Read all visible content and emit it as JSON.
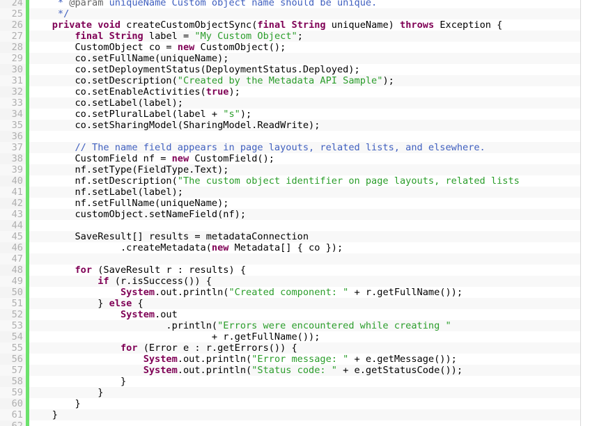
{
  "colors": {
    "gutter_background": "#f4f4f4",
    "accent_bar": "#6ce26c",
    "keyword": "#7f0055",
    "string": "#2a9d2a",
    "comment": "#3f5fbf",
    "line_number": "#afafaf"
  },
  "code": {
    "lines": [
      {
        "n": "24",
        "tokens": [
          [
            "     * ",
            "doc"
          ],
          [
            "@param",
            "ann"
          ],
          [
            " uniqueName Custom object name should be unique.",
            "doc"
          ]
        ]
      },
      {
        "n": "25",
        "tokens": [
          [
            "     */",
            "doc"
          ]
        ]
      },
      {
        "n": "26",
        "tokens": [
          [
            "    ",
            "t"
          ],
          [
            "private",
            "kw"
          ],
          [
            " ",
            "t"
          ],
          [
            "void",
            "kw"
          ],
          [
            " createCustomObjectSync(",
            "t"
          ],
          [
            "final",
            "kw"
          ],
          [
            " ",
            "t"
          ],
          [
            "String",
            "kw"
          ],
          [
            " uniqueName) ",
            "t"
          ],
          [
            "throws",
            "kw"
          ],
          [
            " Exception {",
            "t"
          ]
        ]
      },
      {
        "n": "27",
        "tokens": [
          [
            "        ",
            "t"
          ],
          [
            "final",
            "kw"
          ],
          [
            " ",
            "t"
          ],
          [
            "String",
            "kw"
          ],
          [
            " label = ",
            "t"
          ],
          [
            "\"My Custom Object\"",
            "str"
          ],
          [
            ";",
            "t"
          ]
        ]
      },
      {
        "n": "28",
        "tokens": [
          [
            "        CustomObject co = ",
            "t"
          ],
          [
            "new",
            "kw"
          ],
          [
            " CustomObject();",
            "t"
          ]
        ]
      },
      {
        "n": "29",
        "tokens": [
          [
            "        co.setFullName(uniqueName);",
            "t"
          ]
        ]
      },
      {
        "n": "30",
        "tokens": [
          [
            "        co.setDeploymentStatus(DeploymentStatus.Deployed);",
            "t"
          ]
        ]
      },
      {
        "n": "31",
        "tokens": [
          [
            "        co.setDescription(",
            "t"
          ],
          [
            "\"Created by the Metadata API Sample\"",
            "str"
          ],
          [
            ");",
            "t"
          ]
        ]
      },
      {
        "n": "32",
        "tokens": [
          [
            "        co.setEnableActivities(",
            "t"
          ],
          [
            "true",
            "kw"
          ],
          [
            ");",
            "t"
          ]
        ]
      },
      {
        "n": "33",
        "tokens": [
          [
            "        co.setLabel(label);",
            "t"
          ]
        ]
      },
      {
        "n": "34",
        "tokens": [
          [
            "        co.setPluralLabel(label + ",
            "t"
          ],
          [
            "\"s\"",
            "str"
          ],
          [
            ");",
            "t"
          ]
        ]
      },
      {
        "n": "35",
        "tokens": [
          [
            "        co.setSharingModel(SharingModel.ReadWrite);",
            "t"
          ]
        ]
      },
      {
        "n": "36",
        "tokens": []
      },
      {
        "n": "37",
        "tokens": [
          [
            "        ",
            "t"
          ],
          [
            "// The name field appears in page layouts, related lists, and elsewhere.",
            "cm"
          ]
        ]
      },
      {
        "n": "38",
        "tokens": [
          [
            "        CustomField nf = ",
            "t"
          ],
          [
            "new",
            "kw"
          ],
          [
            " CustomField();",
            "t"
          ]
        ]
      },
      {
        "n": "39",
        "tokens": [
          [
            "        nf.setType(FieldType.Text);",
            "t"
          ]
        ]
      },
      {
        "n": "40",
        "tokens": [
          [
            "        nf.setDescription(",
            "t"
          ],
          [
            "\"The custom object identifier on page layouts, related lists",
            "str"
          ]
        ]
      },
      {
        "n": "41",
        "tokens": [
          [
            "        nf.setLabel(label);",
            "t"
          ]
        ]
      },
      {
        "n": "42",
        "tokens": [
          [
            "        nf.setFullName(uniqueName);",
            "t"
          ]
        ]
      },
      {
        "n": "43",
        "tokens": [
          [
            "        customObject.setNameField(nf);",
            "t"
          ]
        ]
      },
      {
        "n": "44",
        "tokens": []
      },
      {
        "n": "45",
        "tokens": [
          [
            "        SaveResult[] results = metadataConnection",
            "t"
          ]
        ]
      },
      {
        "n": "46",
        "tokens": [
          [
            "                .createMetadata(",
            "t"
          ],
          [
            "new",
            "kw"
          ],
          [
            " Metadata[] { co });",
            "t"
          ]
        ]
      },
      {
        "n": "47",
        "tokens": []
      },
      {
        "n": "48",
        "tokens": [
          [
            "        ",
            "t"
          ],
          [
            "for",
            "kw"
          ],
          [
            " (SaveResult r : results) {",
            "t"
          ]
        ]
      },
      {
        "n": "49",
        "tokens": [
          [
            "            ",
            "t"
          ],
          [
            "if",
            "kw"
          ],
          [
            " (r.isSuccess()) {",
            "t"
          ]
        ]
      },
      {
        "n": "50",
        "tokens": [
          [
            "                ",
            "t"
          ],
          [
            "System",
            "cls"
          ],
          [
            ".out.println(",
            "t"
          ],
          [
            "\"Created component: \"",
            "str"
          ],
          [
            " + r.getFullName());",
            "t"
          ]
        ]
      },
      {
        "n": "51",
        "tokens": [
          [
            "            } ",
            "t"
          ],
          [
            "else",
            "kw"
          ],
          [
            " {",
            "t"
          ]
        ]
      },
      {
        "n": "52",
        "tokens": [
          [
            "                ",
            "t"
          ],
          [
            "System",
            "cls"
          ],
          [
            ".out",
            "t"
          ]
        ]
      },
      {
        "n": "53",
        "tokens": [
          [
            "                        .println(",
            "t"
          ],
          [
            "\"Errors were encountered while creating \"",
            "str"
          ]
        ]
      },
      {
        "n": "54",
        "tokens": [
          [
            "                                + r.getFullName());",
            "t"
          ]
        ]
      },
      {
        "n": "55",
        "tokens": [
          [
            "                ",
            "t"
          ],
          [
            "for",
            "kw"
          ],
          [
            " (Error e : r.getErrors()) {",
            "t"
          ]
        ]
      },
      {
        "n": "56",
        "tokens": [
          [
            "                    ",
            "t"
          ],
          [
            "System",
            "cls"
          ],
          [
            ".out.println(",
            "t"
          ],
          [
            "\"Error message: \"",
            "str"
          ],
          [
            " + e.getMessage());",
            "t"
          ]
        ]
      },
      {
        "n": "57",
        "tokens": [
          [
            "                    ",
            "t"
          ],
          [
            "System",
            "cls"
          ],
          [
            ".out.println(",
            "t"
          ],
          [
            "\"Status code: \"",
            "str"
          ],
          [
            " + e.getStatusCode());",
            "t"
          ]
        ]
      },
      {
        "n": "58",
        "tokens": [
          [
            "                }",
            "t"
          ]
        ]
      },
      {
        "n": "59",
        "tokens": [
          [
            "            }",
            "t"
          ]
        ]
      },
      {
        "n": "60",
        "tokens": [
          [
            "        }",
            "t"
          ]
        ]
      },
      {
        "n": "61",
        "tokens": [
          [
            "    }",
            "t"
          ]
        ]
      },
      {
        "n": "62",
        "tokens": []
      }
    ]
  }
}
